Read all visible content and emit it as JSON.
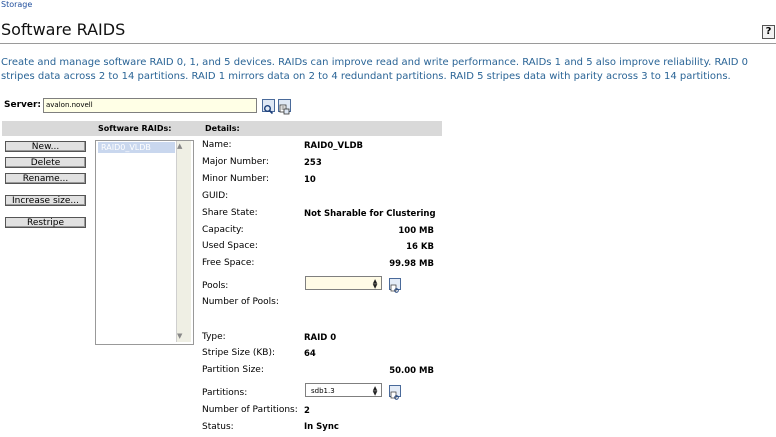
{
  "breadcrumb": "Storage",
  "title": "Software RAIDS",
  "help_label": "?",
  "description": "Create and manage software RAID 0, 1, and 5 devices. RAIDs can improve read and write performance. RAIDs 1 and 5 also improve reliability. RAID 0 stripes data across 2 to 14 partitions. RAID 1 mirrors data on 2 to 4 redundant partitions. RAID 5 stripes data with parity across 3 to 14 partitions.",
  "server": {
    "label": "Server:",
    "value": "avalon.novell"
  },
  "headers": {
    "raids": "Software RAIDs:",
    "details": "Details:"
  },
  "buttons": {
    "new": "New...",
    "delete": "Delete",
    "rename": "Rename...",
    "increase": "Increase size...",
    "restripe": "Restripe"
  },
  "raid_list": [
    "RAID0_VLDB"
  ],
  "details": {
    "name": {
      "label": "Name:",
      "value": "RAID0_VLDB"
    },
    "major": {
      "label": "Major Number:",
      "value": "253"
    },
    "minor": {
      "label": "Minor Number:",
      "value": "10"
    },
    "guid": {
      "label": "GUID:",
      "value": ""
    },
    "share": {
      "label": "Share State:",
      "value": "Not Sharable for Clustering"
    },
    "capacity": {
      "label": "Capacity:",
      "value": "100 MB"
    },
    "used": {
      "label": "Used Space:",
      "value": "16 KB"
    },
    "free": {
      "label": "Free Space:",
      "value": "99.98 MB"
    },
    "pools": {
      "label": "Pools:",
      "value": ""
    },
    "num_pools": {
      "label": "Number of Pools:",
      "value": ""
    },
    "type": {
      "label": "Type:",
      "value": "RAID 0"
    },
    "stripe": {
      "label": "Stripe Size (KB):",
      "value": "64"
    },
    "partition_size": {
      "label": "Partition Size:",
      "value": "50.00 MB"
    },
    "partitions": {
      "label": "Partitions:",
      "value": "sdb1.3"
    },
    "num_partitions": {
      "label": "Number of Partitions:",
      "value": "2"
    },
    "status": {
      "label": "Status:",
      "value": "In Sync"
    }
  },
  "icons": {
    "search": "search-icon",
    "browse": "browse-icon",
    "pool_details": "details-icon",
    "partition_details": "details-icon"
  },
  "colors": {
    "description_text": "#2a6496",
    "selected_item": "#c9d7ee",
    "header_bar": "#d9d9d9"
  }
}
